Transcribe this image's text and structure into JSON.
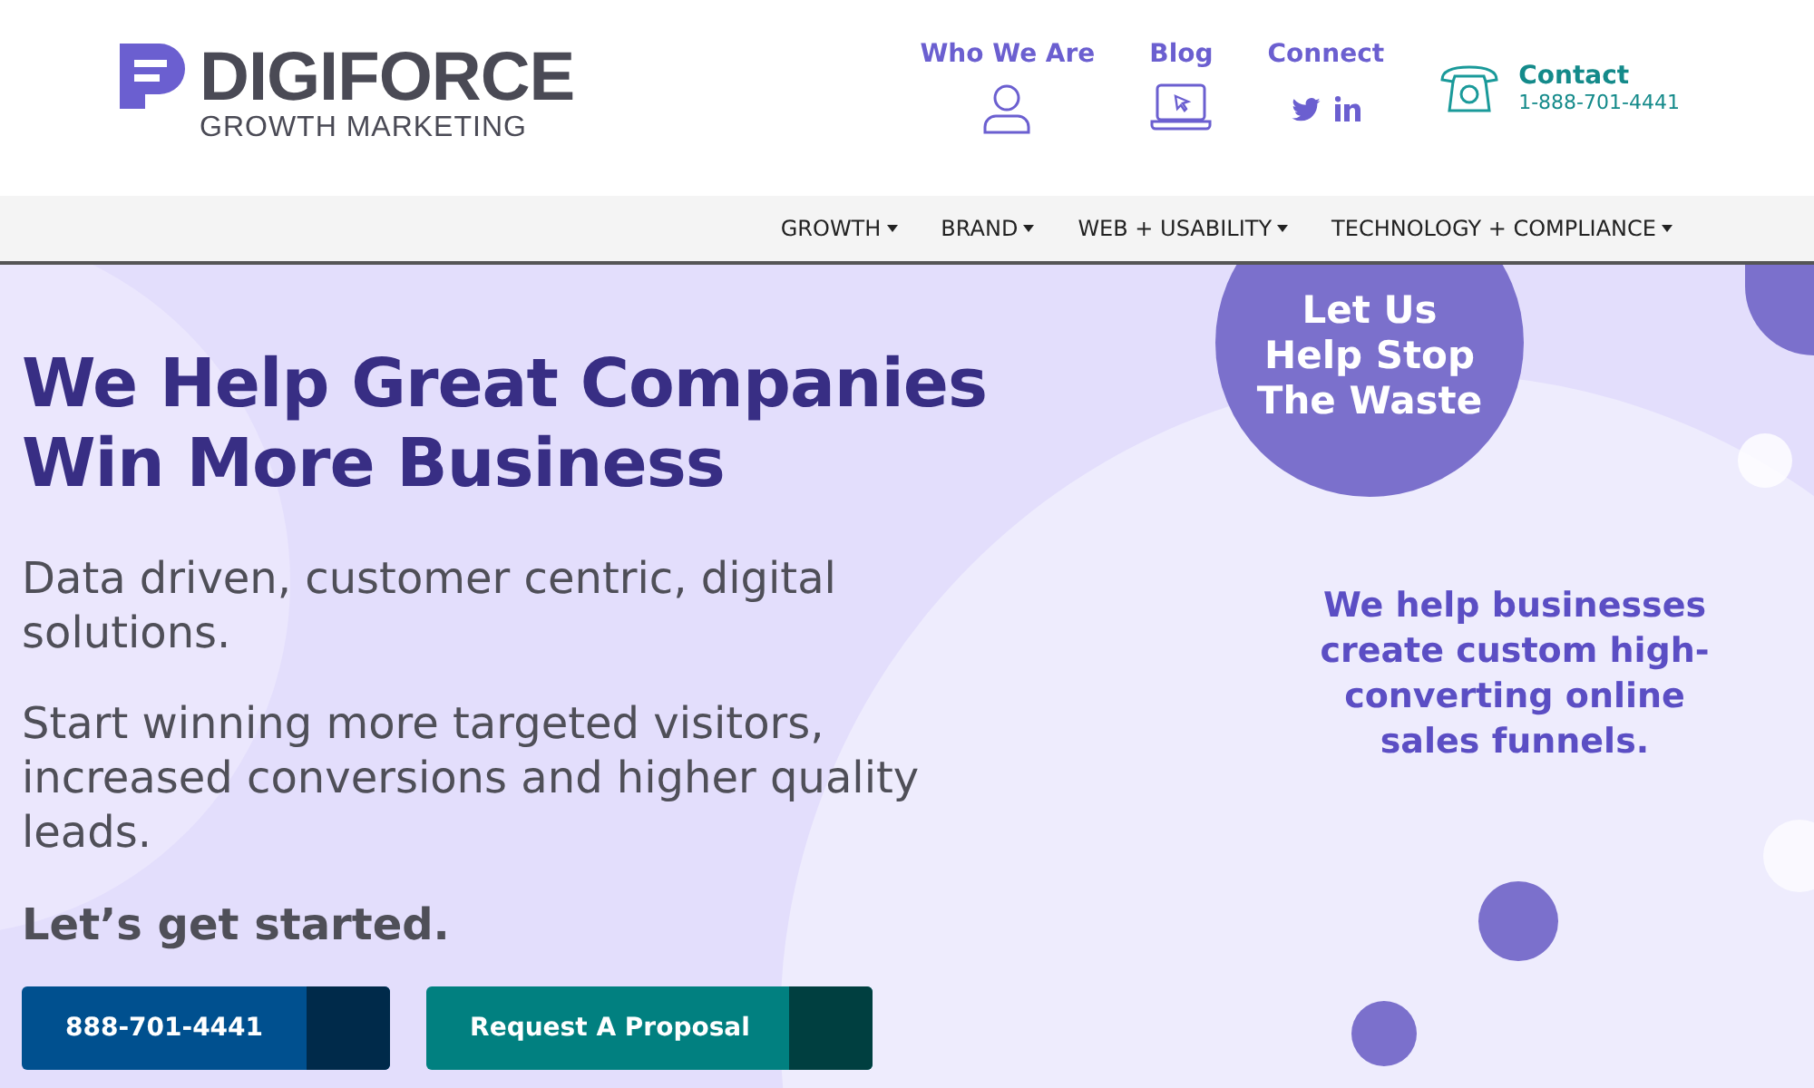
{
  "logo": {
    "name": "DIGIFORCE",
    "tagline": "GROWTH MARKETING"
  },
  "top_links": [
    {
      "label": "Who We Are",
      "kind": "person"
    },
    {
      "label": "Blog",
      "kind": "laptop"
    },
    {
      "label": "Connect",
      "kind": "social"
    }
  ],
  "contact": {
    "label": "Contact",
    "phone": "1-888-701-4441"
  },
  "nav": [
    {
      "label": "GROWTH"
    },
    {
      "label": "BRAND"
    },
    {
      "label": "WEB + USABILITY"
    },
    {
      "label": "TECHNOLOGY + COMPLIANCE"
    }
  ],
  "hero": {
    "headline": "We Help Great Companies Win More Business",
    "paragraphs": [
      "Data driven, customer centric, digital solutions.",
      "Start winning more targeted visitors, increased conversions and higher quality leads."
    ],
    "cta_heading": "Let’s get started.",
    "buttons": [
      {
        "label": "888-701-4441",
        "kind": "phone"
      },
      {
        "label": "Request A Proposal",
        "kind": "proposal"
      }
    ],
    "badge": "Let Us Help Stop The Waste",
    "tagline": "We help businesses create custom high-converting online sales funnels."
  }
}
